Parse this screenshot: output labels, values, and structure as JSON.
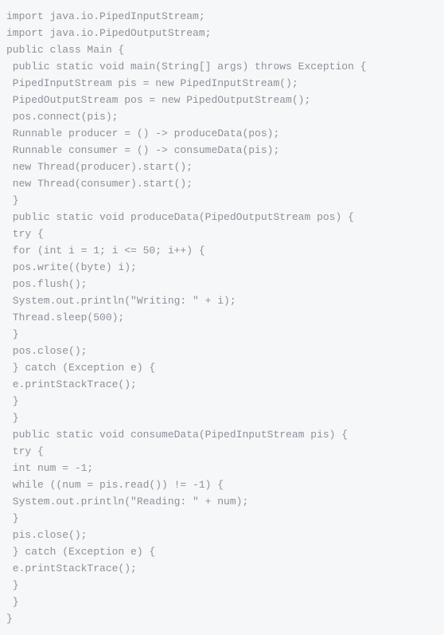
{
  "code": {
    "lines": [
      "import java.io.PipedInputStream;",
      "import java.io.PipedOutputStream;",
      "public class Main {",
      " public static void main(String[] args) throws Exception {",
      " PipedInputStream pis = new PipedInputStream();",
      " PipedOutputStream pos = new PipedOutputStream();",
      " pos.connect(pis);",
      " Runnable producer = () -> produceData(pos);",
      " Runnable consumer = () -> consumeData(pis);",
      " new Thread(producer).start();",
      " new Thread(consumer).start();",
      " }",
      " public static void produceData(PipedOutputStream pos) {",
      " try {",
      " for (int i = 1; i <= 50; i++) {",
      " pos.write((byte) i);",
      " pos.flush();",
      " System.out.println(\"Writing: \" + i);",
      " Thread.sleep(500);",
      " }",
      " pos.close();",
      " } catch (Exception e) {",
      " e.printStackTrace();",
      " }",
      " }",
      " public static void consumeData(PipedInputStream pis) {",
      " try {",
      " int num = -1;",
      " while ((num = pis.read()) != -1) {",
      " System.out.println(\"Reading: \" + num);",
      " }",
      " pis.close();",
      " } catch (Exception e) {",
      " e.printStackTrace();",
      " }",
      " }",
      "}"
    ]
  }
}
